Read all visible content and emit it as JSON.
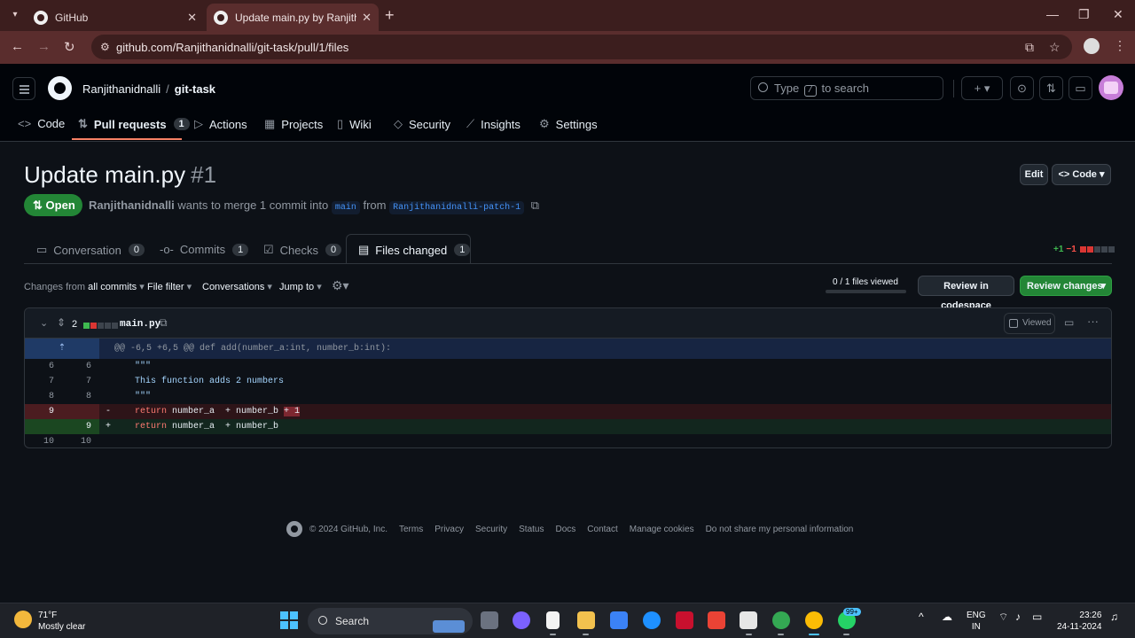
{
  "browser": {
    "tabs": [
      {
        "title": "GitHub",
        "active": false
      },
      {
        "title": "Update main.py by Ranjithanidnalli",
        "active": true
      }
    ],
    "url": "github.com/Ranjithanidnalli/git-task/pull/1/files"
  },
  "header": {
    "owner": "Ranjithanidnalli",
    "separator": "/",
    "repo": "git-task",
    "search_prefix": "Type",
    "search_key": "/",
    "search_suffix": "to search",
    "plus": "+"
  },
  "repo_nav": [
    {
      "label": "Code",
      "icon": "code-icon"
    },
    {
      "label": "Pull requests",
      "count": "1",
      "icon": "pull-request-icon"
    },
    {
      "label": "Actions",
      "icon": "play-icon"
    },
    {
      "label": "Projects",
      "icon": "table-icon"
    },
    {
      "label": "Wiki",
      "icon": "book-icon"
    },
    {
      "label": "Security",
      "icon": "shield-icon"
    },
    {
      "label": "Insights",
      "icon": "graph-icon"
    },
    {
      "label": "Settings",
      "icon": "gear-icon"
    }
  ],
  "pr": {
    "title": "Update main.py",
    "number": "#1",
    "edit_label": "Edit",
    "code_label": "Code",
    "state": "Open",
    "author": "Ranjithanidnalli",
    "merge_text": "wants to merge 1 commit into",
    "base_branch": "main",
    "from_text": "from",
    "head_branch": "Ranjithanidnalli-patch-1"
  },
  "pr_tabs": [
    {
      "label": "Conversation",
      "count": "0"
    },
    {
      "label": "Commits",
      "count": "1"
    },
    {
      "label": "Checks",
      "count": "0"
    },
    {
      "label": "Files changed",
      "count": "1"
    }
  ],
  "diffstat": {
    "additions": "+1",
    "deletions": "−1"
  },
  "toolbar": {
    "changes_from_prefix": "Changes from",
    "changes_from_value": "all commits",
    "file_filter": "File filter",
    "conversations": "Conversations",
    "jump_to": "Jump to",
    "files_viewed": "0 / 1 files viewed",
    "files_viewed_progress": 0,
    "review_codespace": "Review in codespace",
    "review_changes": "Review changes"
  },
  "file": {
    "changes": "2",
    "name": "main.py",
    "viewed_label": "Viewed",
    "hunk_header": "@@ -6,5 +6,5 @@ def add(number_a:int, number_b:int):",
    "lines": [
      {
        "type": "context",
        "old": "6",
        "new": "6",
        "code": "\"\"\""
      },
      {
        "type": "context",
        "old": "7",
        "new": "7",
        "code": "This function adds 2 numbers"
      },
      {
        "type": "context",
        "old": "8",
        "new": "8",
        "code": "\"\"\""
      },
      {
        "type": "del",
        "old": "9",
        "new": "",
        "marker": "-",
        "kw": "return",
        "code": " number_a  + number_b ",
        "highlight": "+ 1"
      },
      {
        "type": "add",
        "old": "",
        "new": "9",
        "marker": "+",
        "kw": "return",
        "code": " number_a  + number_b",
        "highlight": ""
      },
      {
        "type": "context",
        "old": "10",
        "new": "10",
        "code": ""
      }
    ]
  },
  "footer": {
    "copyright": "© 2024 GitHub, Inc.",
    "links": [
      "Terms",
      "Privacy",
      "Security",
      "Status",
      "Docs",
      "Contact",
      "Manage cookies",
      "Do not share my personal information"
    ]
  },
  "taskbar": {
    "temp": "71°F",
    "weather": "Mostly clear",
    "search": "Search",
    "lang1": "ENG",
    "lang2": "IN",
    "time": "23:26",
    "date": "24-11-2024",
    "whatsapp_badge": "99+"
  },
  "colors": {
    "accent_green": "#238636",
    "link_blue": "#4493f8",
    "underline_orange": "#f78166",
    "diff_del_bg": "#2d1418",
    "diff_add_bg": "#12261e"
  }
}
